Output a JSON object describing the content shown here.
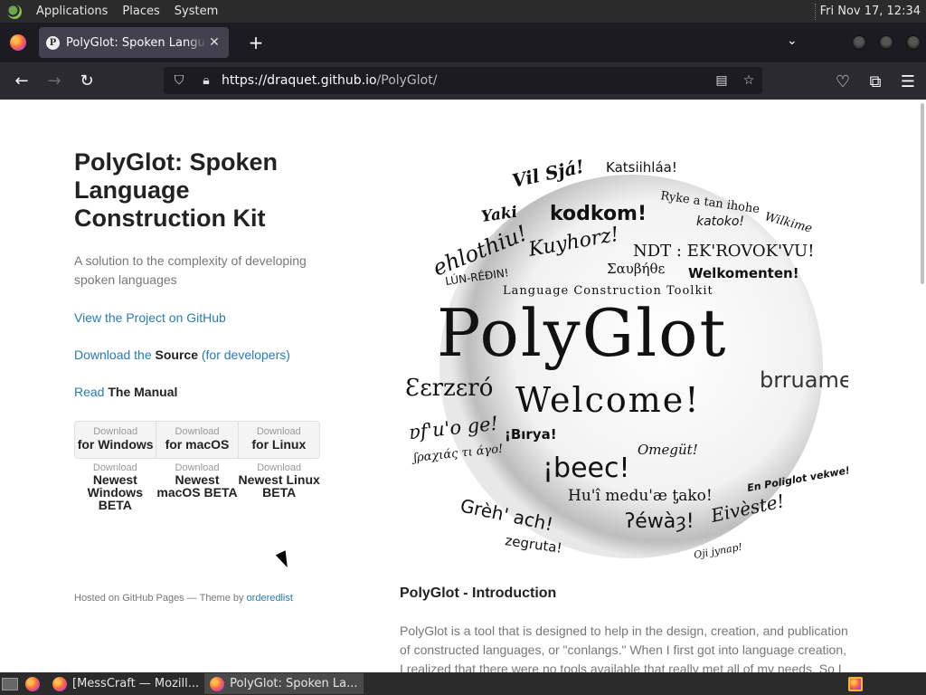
{
  "top_panel": {
    "menus": [
      "Applications",
      "Places",
      "System"
    ],
    "clock": "Fri Nov 17, 12:34"
  },
  "browser": {
    "tab_title": "PolyGlot: Spoken Language Construction Kit",
    "tab_favicon": "P",
    "url_host": "https://draquet.github.io",
    "url_path": "/PolyGlot/"
  },
  "page": {
    "title": "PolyGlot: Spoken Language Construction Kit",
    "description": "A solution to the complexity of developing spoken languages",
    "project_link": "View the Project on GitHub",
    "download_source": {
      "prefix": "Download the ",
      "bold": "Source",
      "suffix": " (for developers)"
    },
    "manual": {
      "prefix": "Read ",
      "bold": "The Manual"
    },
    "downloads": [
      {
        "small": "Download",
        "big": "for Windows"
      },
      {
        "small": "Download",
        "big": "for macOS"
      },
      {
        "small": "Download",
        "big": "for Linux"
      }
    ],
    "beta_downloads": [
      {
        "small": "Download",
        "big": "Newest Windows BETA"
      },
      {
        "small": "Download",
        "big": "Newest macOS BETA"
      },
      {
        "small": "Download",
        "big": "Newest Linux BETA"
      }
    ],
    "footer": {
      "text": "Hosted on GitHub Pages — Theme by ",
      "link": "orderedlist"
    },
    "logo": {
      "main": "PolyGlot",
      "subtitle": "Language Construction Toolkit",
      "welcome": "Welcome!",
      "words": [
        "Vil Sjá!",
        "Katsiihláa!",
        "Yaki",
        "kodkom!",
        "Ryke a tan ihohe",
        "katoko!",
        "Wilkime",
        "ehlothiu!",
        "Kuyhorz!",
        "NDT : EK'ROVOK'VU!",
        "Σαυβήθε",
        "LÚN-RÉÐIN!",
        "Welkomenten!",
        "Ɛɛrzɛró",
        "brruame!",
        "ɐf'u'o ge!",
        "¡Bırya!",
        "Omegüt!",
        "ʃραχιάς τι άγο!",
        "¡beec!",
        "Hu'î medu'æ ƫako!",
        "En Poliglot vekwe!",
        "ʔéwàȝ!",
        "Eivèste!",
        "Grèh' ach!",
        "zegruta!",
        "Oji jynap!"
      ]
    },
    "intro_title": "PolyGlot - Introduction",
    "intro_text": "PolyGlot is a tool that is designed to help in the design, creation, and publication of constructed languages, or \"conlangs.\" When I first got into language creation, I realized that there were no tools available that really met all of my needs. So I"
  },
  "taskbar": {
    "tasks": [
      {
        "label": "[MessCraft — Mozill...",
        "active": false
      },
      {
        "label": "PolyGlot: Spoken La...",
        "active": true
      }
    ]
  }
}
